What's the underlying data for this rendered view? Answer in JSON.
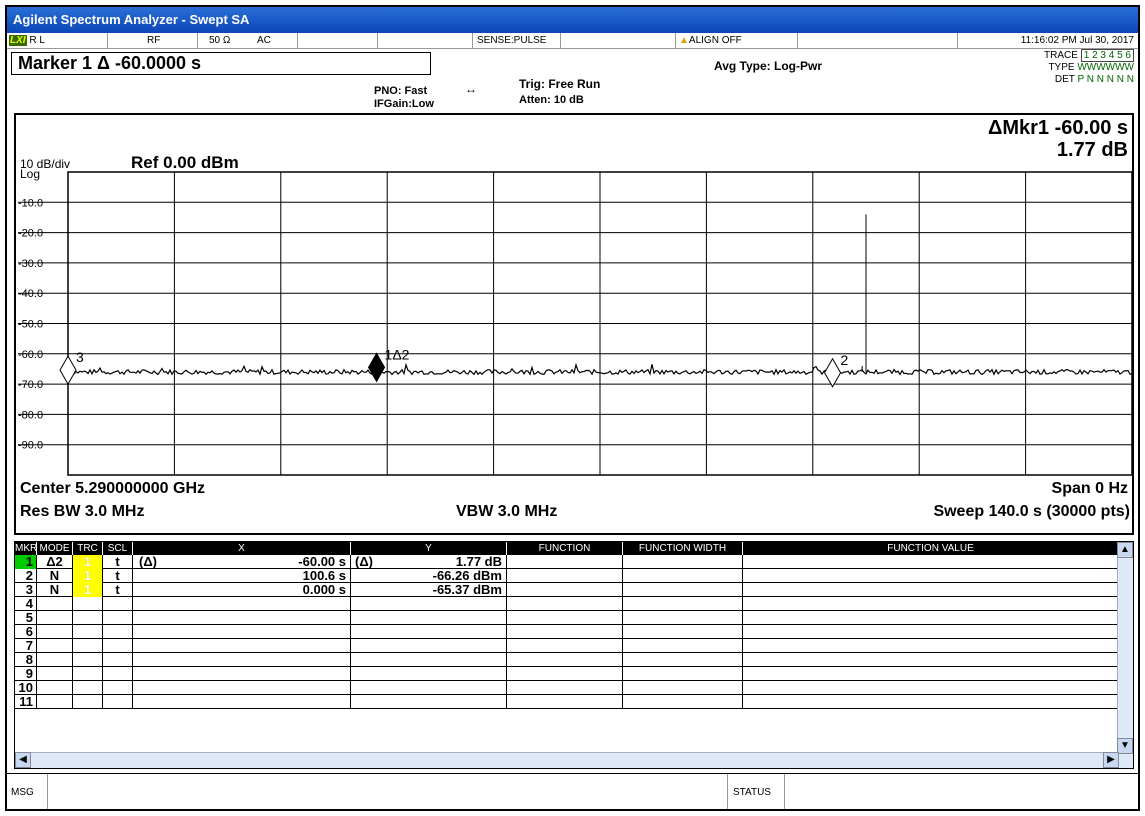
{
  "window": {
    "title": "Agilent Spectrum Analyzer - Swept SA"
  },
  "status_row": {
    "rl": "R L",
    "rf": "RF",
    "impedance": "50 Ω",
    "coupling": "AC",
    "sense": "SENSE:PULSE",
    "align": "ALIGN OFF",
    "datetime": "11:16:02 PM Jul 30, 2017"
  },
  "marker_header": "Marker 1 Δ -60.0000 s",
  "settings": {
    "pno": "PNO: Fast",
    "ifgain": "IFGain:Low",
    "trig": "Trig: Free Run",
    "atten": "Atten: 10 dB",
    "avg_type": "Avg Type: Log-Pwr"
  },
  "trace_panel": {
    "trace_label": "TRACE",
    "trace_nums": "1 2 3 4 5 6",
    "type_label": "TYPE",
    "type_val": "WWWWWW",
    "det_label": "DET",
    "det_val": "P N N N N N"
  },
  "plot": {
    "scale": "10 dB/div",
    "log": "Log",
    "ref": "Ref 0.00 dBm",
    "delta_mkr": "ΔMkr1 -60.00 s",
    "delta_val": "1.77 dB",
    "center": "Center 5.290000000 GHz",
    "span": "Span 0 Hz",
    "res_bw": "Res BW 3.0 MHz",
    "vbw": "VBW 3.0 MHz",
    "sweep": "Sweep  140.0 s (30000 pts)",
    "marker_labels": {
      "m1": "1Δ2",
      "m2": "2",
      "m3": "3"
    }
  },
  "chart_data": {
    "type": "line",
    "ylim": [
      -100,
      0
    ],
    "y_ticks": [
      "-10.0",
      "-20.0",
      "-30.0",
      "-40.0",
      "-50.0",
      "-60.0",
      "-70.0",
      "-80.0",
      "-90.0"
    ],
    "xlim": [
      0,
      140
    ],
    "noise_floor": -66,
    "spikes": [
      {
        "x": 105,
        "y": -14
      },
      {
        "x": 104.5,
        "y": -64
      }
    ],
    "markers": [
      {
        "id": "1",
        "x": 40.6,
        "y": -64.5,
        "filled": true
      },
      {
        "id": "2",
        "x": 100.6,
        "y": -66.26,
        "filled": false
      },
      {
        "id": "3",
        "x": 0.0,
        "y": -65.37,
        "filled": false
      }
    ]
  },
  "table": {
    "headers": [
      "MKR",
      "MODE",
      "TRC",
      "SCL",
      "X",
      "Y",
      "FUNCTION",
      "FUNCTION WIDTH",
      "FUNCTION VALUE"
    ],
    "rows": [
      {
        "mkr": "1",
        "mode": "Δ2",
        "trc": "1",
        "scl": "t",
        "xpre": "(Δ)",
        "x": "-60.00 s",
        "ypre": "(Δ)",
        "y": "1.77 dB"
      },
      {
        "mkr": "2",
        "mode": "N",
        "trc": "1",
        "scl": "t",
        "xpre": "",
        "x": "100.6 s",
        "ypre": "",
        "y": "-66.26 dBm"
      },
      {
        "mkr": "3",
        "mode": "N",
        "trc": "1",
        "scl": "t",
        "xpre": "",
        "x": "0.000 s",
        "ypre": "",
        "y": "-65.37 dBm"
      },
      {
        "mkr": "4",
        "mode": "",
        "trc": "",
        "scl": "",
        "xpre": "",
        "x": "",
        "ypre": "",
        "y": ""
      },
      {
        "mkr": "5",
        "mode": "",
        "trc": "",
        "scl": "",
        "xpre": "",
        "x": "",
        "ypre": "",
        "y": ""
      },
      {
        "mkr": "6",
        "mode": "",
        "trc": "",
        "scl": "",
        "xpre": "",
        "x": "",
        "ypre": "",
        "y": ""
      },
      {
        "mkr": "7",
        "mode": "",
        "trc": "",
        "scl": "",
        "xpre": "",
        "x": "",
        "ypre": "",
        "y": ""
      },
      {
        "mkr": "8",
        "mode": "",
        "trc": "",
        "scl": "",
        "xpre": "",
        "x": "",
        "ypre": "",
        "y": ""
      },
      {
        "mkr": "9",
        "mode": "",
        "trc": "",
        "scl": "",
        "xpre": "",
        "x": "",
        "ypre": "",
        "y": ""
      },
      {
        "mkr": "10",
        "mode": "",
        "trc": "",
        "scl": "",
        "xpre": "",
        "x": "",
        "ypre": "",
        "y": ""
      },
      {
        "mkr": "11",
        "mode": "",
        "trc": "",
        "scl": "",
        "xpre": "",
        "x": "",
        "ypre": "",
        "y": ""
      }
    ]
  },
  "msgbar": {
    "msg": "MSG",
    "status": "STATUS"
  },
  "colors": {
    "title_bar": "#0b47b8",
    "trace_yellow": "#ffff00",
    "marker_active": "#00cc00"
  }
}
